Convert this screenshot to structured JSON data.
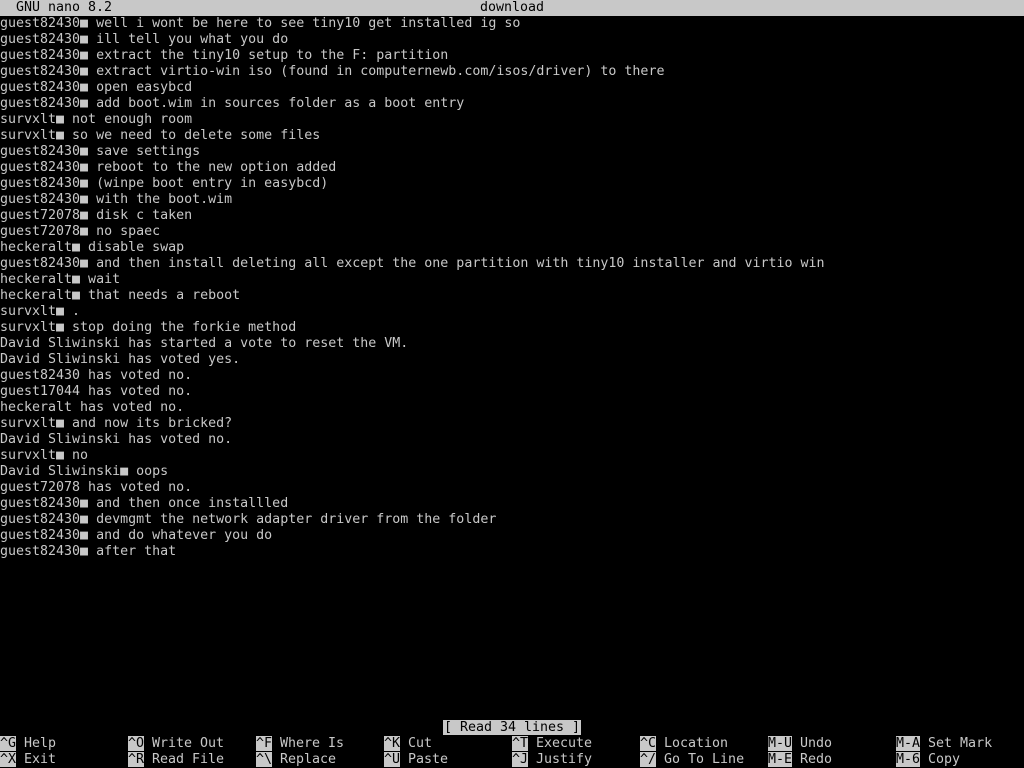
{
  "titlebar": {
    "app": "GNU nano 8.2",
    "filename": "download"
  },
  "lines": [
    "guest82430■ well i wont be here to see tiny10 get installed ig so",
    "guest82430■ ill tell you what you do",
    "guest82430■ extract the tiny10 setup to the F: partition",
    "guest82430■ extract virtio-win iso (found in computernewb.com/isos/driver) to there",
    "guest82430■ open easybcd",
    "guest82430■ add boot.wim in sources folder as a boot entry",
    "survxlt■ not enough room",
    "survxlt■ so we need to delete some files",
    "guest82430■ save settings",
    "guest82430■ reboot to the new option added",
    "guest82430■ (winpe boot entry in easybcd)",
    "guest82430■ with the boot.wim",
    "guest72078■ disk c taken",
    "guest72078■ no spaec",
    "heckeralt■ disable swap",
    "guest82430■ and then install deleting all except the one partition with tiny10 installer and virtio win",
    "heckeralt■ wait",
    "heckeralt■ that needs a reboot",
    "survxlt■ .",
    "survxlt■ stop doing the forkie method",
    "David Sliwinski has started a vote to reset the VM.",
    "David Sliwinski has voted yes.",
    "guest82430 has voted no.",
    "guest17044 has voted no.",
    "heckeralt has voted no.",
    "survxlt■ and now its bricked?",
    "David Sliwinski has voted no.",
    "survxlt■ no",
    "David Sliwinski■ oops",
    "guest72078 has voted no.",
    "guest82430■ and then once installled",
    "guest82430■ devmgmt the network adapter driver from the folder",
    "guest82430■ and do whatever you do",
    "guest82430■ after that"
  ],
  "status": "[ Read 34 lines ]",
  "shortcuts": [
    {
      "key": "^G",
      "label": "Help"
    },
    {
      "key": "^X",
      "label": "Exit"
    },
    {
      "key": "^O",
      "label": "Write Out"
    },
    {
      "key": "^R",
      "label": "Read File"
    },
    {
      "key": "^F",
      "label": "Where Is"
    },
    {
      "key": "^\\",
      "label": "Replace"
    },
    {
      "key": "^K",
      "label": "Cut"
    },
    {
      "key": "^U",
      "label": "Paste"
    },
    {
      "key": "^T",
      "label": "Execute"
    },
    {
      "key": "^J",
      "label": "Justify"
    },
    {
      "key": "^C",
      "label": "Location"
    },
    {
      "key": "^/",
      "label": "Go To Line"
    },
    {
      "key": "M-U",
      "label": "Undo"
    },
    {
      "key": "M-E",
      "label": "Redo"
    },
    {
      "key": "M-A",
      "label": "Set Mark"
    },
    {
      "key": "M-6",
      "label": "Copy"
    }
  ]
}
